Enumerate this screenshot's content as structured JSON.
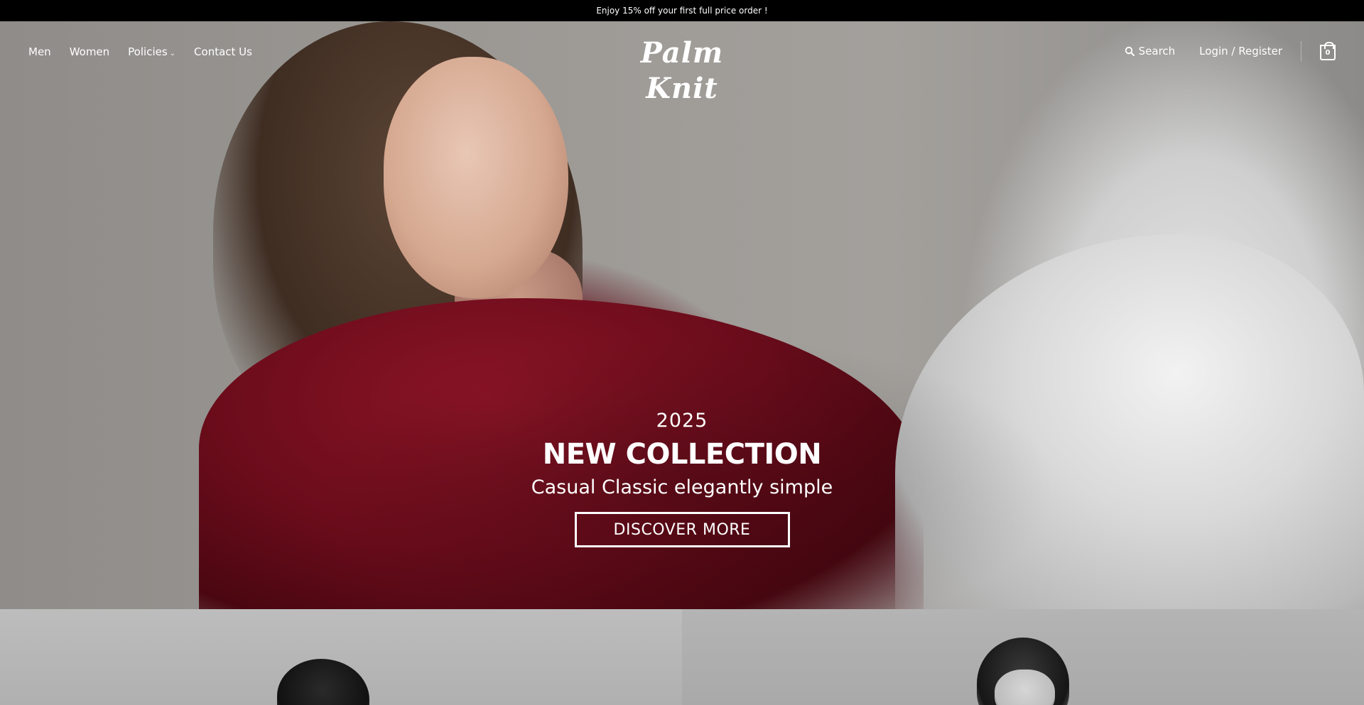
{
  "announcement": {
    "text": "Enjoy 15% off your first full price order !"
  },
  "nav": {
    "links": [
      {
        "label": "Men"
      },
      {
        "label": "Women"
      },
      {
        "label": "Policies"
      },
      {
        "label": "Contact Us"
      }
    ],
    "logo": "Palm Knit",
    "search_label": "Search",
    "login_label": "Login / Register",
    "cart_count": "0"
  },
  "hero": {
    "year": "2025",
    "title": "NEW COLLECTION",
    "subtitle": "Casual Classic elegantly simple",
    "cta_label": "DISCOVER MORE"
  },
  "icons": [
    "search-icon",
    "chevron-down-icon",
    "shopping-bag-icon"
  ],
  "colors": {
    "announcement_bg": "#000000",
    "text": "#ffffff",
    "coat_red": "#6b0c1b"
  }
}
